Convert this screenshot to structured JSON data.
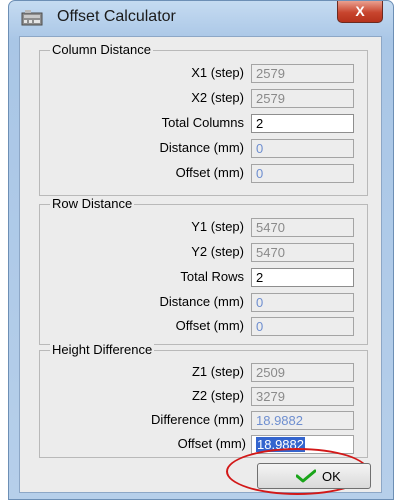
{
  "window": {
    "title": "Offset Calculator",
    "close_label": "X"
  },
  "groups": {
    "column": {
      "title": "Column Distance",
      "x1": {
        "label": "X1 (step)",
        "value": "2579"
      },
      "x2": {
        "label": "X2 (step)",
        "value": "2579"
      },
      "total": {
        "label": "Total Columns",
        "value": "2"
      },
      "distance": {
        "label": "Distance (mm)",
        "value": "0"
      },
      "offset": {
        "label": "Offset (mm)",
        "value": "0"
      }
    },
    "row": {
      "title": "Row Distance",
      "y1": {
        "label": "Y1 (step)",
        "value": "5470"
      },
      "y2": {
        "label": "Y2 (step)",
        "value": "5470"
      },
      "total": {
        "label": "Total Rows",
        "value": "2"
      },
      "distance": {
        "label": "Distance (mm)",
        "value": "0"
      },
      "offset": {
        "label": "Offset (mm)",
        "value": "0"
      }
    },
    "height": {
      "title": "Height Difference",
      "z1": {
        "label": "Z1 (step)",
        "value": "2509"
      },
      "z2": {
        "label": "Z2 (step)",
        "value": "3279"
      },
      "difference": {
        "label": "Difference (mm)",
        "value": "18.9882"
      },
      "offset": {
        "label": "Offset (mm)",
        "value": "18.9882"
      }
    }
  },
  "ok_label": "OK",
  "colors": {
    "highlight_circle": "#d21818",
    "selection": "#3465ce",
    "value_blue": "#6f8fd0"
  }
}
